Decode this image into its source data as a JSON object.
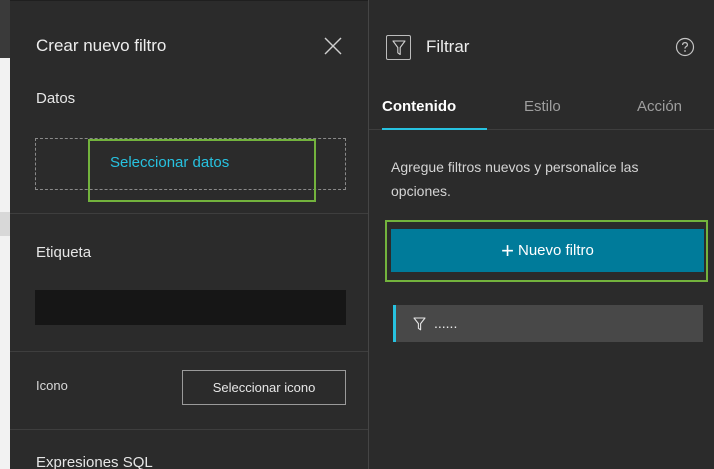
{
  "left_panel": {
    "title": "Crear nuevo filtro",
    "data_section_label": "Datos",
    "select_data_link": "Seleccionar datos",
    "label_section": "Etiqueta",
    "label_value": "",
    "icon_label": "Icono",
    "select_icon_button": "Seleccionar icono",
    "sql_section": "Expresiones SQL"
  },
  "right_panel": {
    "title": "Filtrar",
    "tabs": [
      {
        "label": "Contenido",
        "active": true
      },
      {
        "label": "Estilo",
        "active": false
      },
      {
        "label": "Acción",
        "active": false
      }
    ],
    "description": "Agregue filtros nuevos y personalice las opciones.",
    "new_filter_button": "Nuevo filtro",
    "filter_items": [
      {
        "label": "......"
      }
    ]
  },
  "icons": {
    "close": "close-icon",
    "filter": "filter-icon",
    "help": "help-icon",
    "plus": "plus-icon"
  },
  "colors": {
    "panel_bg": "#2b2b2b",
    "accent_cyan": "#27c2e0",
    "primary_button": "#007b9a",
    "highlight_green": "#73b33d",
    "input_bg": "#161616"
  }
}
